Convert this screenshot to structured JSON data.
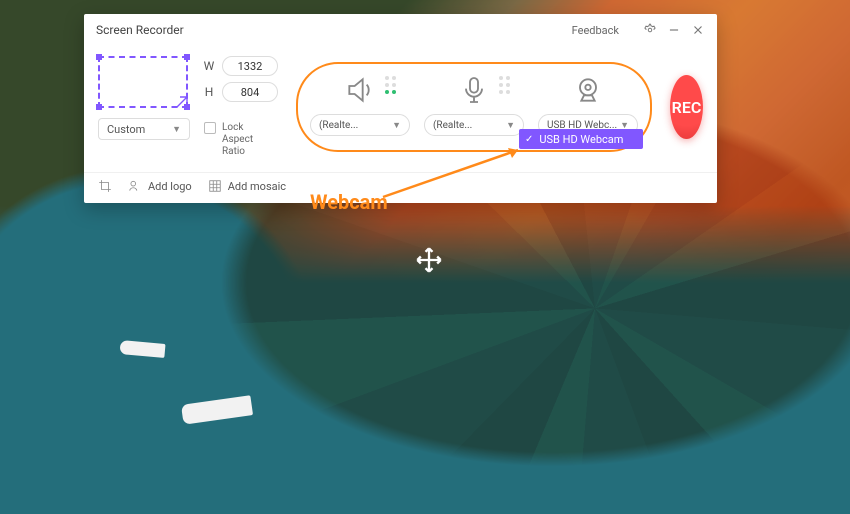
{
  "window": {
    "title": "Screen Recorder",
    "feedback": "Feedback"
  },
  "region": {
    "width_label": "W",
    "width_value": "1332",
    "height_label": "H",
    "height_value": "804",
    "preset": "Custom",
    "lock_label": "Lock Aspect Ratio"
  },
  "devices": {
    "speaker": {
      "selected": "(Realte..."
    },
    "mic": {
      "selected": "(Realte..."
    },
    "webcam": {
      "selected": "USB HD Webc...",
      "dropdown_item": "USB HD Webcam"
    }
  },
  "record": {
    "label": "REC"
  },
  "toolbar": {
    "add_logo": "Add logo",
    "add_mosaic": "Add mosaic"
  },
  "annotation": {
    "label": "Webcam"
  },
  "colors": {
    "accent_purple": "#8157ff",
    "annotation_orange": "#ff8a1a",
    "record_red": "#e83a3a"
  }
}
